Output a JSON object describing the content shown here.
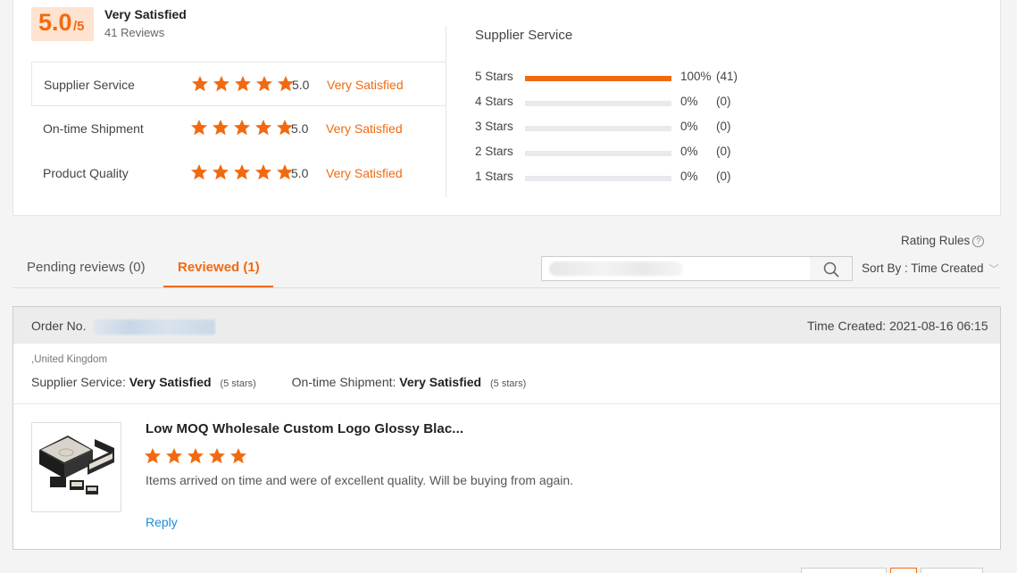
{
  "overall": {
    "score": "5.0",
    "out_of": "/5",
    "title": "Very Satisfied",
    "reviews": "41 Reviews"
  },
  "dimensions": [
    {
      "label": "Supplier Service",
      "stars": 5,
      "score": "5.0",
      "text": "Very Satisfied"
    },
    {
      "label": "On-time Shipment",
      "stars": 5,
      "score": "5.0",
      "text": "Very Satisfied"
    },
    {
      "label": "Product Quality",
      "stars": 5,
      "score": "5.0",
      "text": "Very Satisfied"
    }
  ],
  "distribution": {
    "title": "Supplier Service",
    "rows": [
      {
        "label": "5  Stars",
        "fraction": 1.0,
        "pct": "100%",
        "count": "(41)"
      },
      {
        "label": "4  Stars",
        "fraction": 0,
        "pct": "0%",
        "count": "(0)"
      },
      {
        "label": "3  Stars",
        "fraction": 0,
        "pct": "0%",
        "count": "(0)"
      },
      {
        "label": "2  Stars",
        "fraction": 0,
        "pct": "0%",
        "count": "(0)"
      },
      {
        "label": "1  Stars",
        "fraction": 0,
        "pct": "0%",
        "count": "(0)"
      }
    ]
  },
  "rating_rules": "Rating Rules",
  "tabs": {
    "pending": "Pending reviews (0)",
    "reviewed": "Reviewed (1)"
  },
  "sort": {
    "label": "Sort By : Time Created"
  },
  "order": {
    "order_no_label": "Order No.",
    "time_created": "Time Created: 2021-08-16 06:15",
    "location": ",United Kingdom",
    "supplier_service_label": "Supplier Service:",
    "supplier_service_value": "Very Satisfied",
    "supplier_service_stars": "(5 stars)",
    "shipment_label": "On-time Shipment:",
    "shipment_value": "Very Satisfied",
    "shipment_stars": "(5 stars)",
    "product_title": "Low MOQ Wholesale Custom Logo Glossy Blac...",
    "review_stars": 5,
    "review_text": "Items arrived on time and were of excellent quality. Will be buying from again.",
    "reply": "Reply"
  },
  "colors": {
    "accent": "#f26a10",
    "link": "#1a8fd8",
    "badge_bg": "#fde3d0"
  }
}
